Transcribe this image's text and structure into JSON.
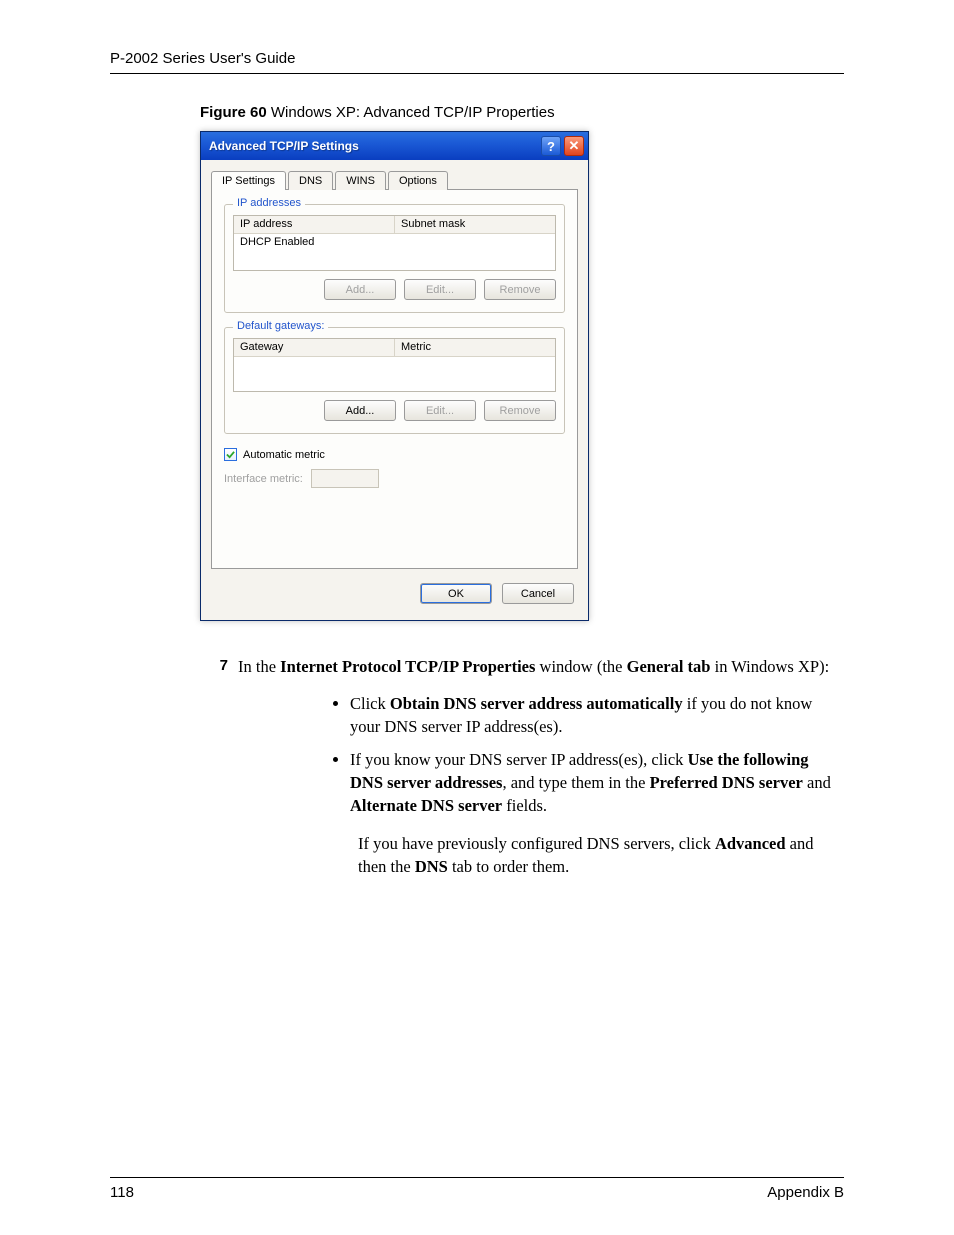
{
  "header": {
    "title": "P-2002 Series User's Guide"
  },
  "figure": {
    "label_bold": "Figure 60",
    "label_rest": "   Windows XP: Advanced TCP/IP Properties"
  },
  "dialog": {
    "title": "Advanced TCP/IP Settings",
    "tabs": {
      "ip": "IP Settings",
      "dns": "DNS",
      "wins": "WINS",
      "options": "Options"
    },
    "group_ip": {
      "legend": "IP addresses",
      "col1": "IP address",
      "col2": "Subnet mask",
      "row1": "DHCP Enabled"
    },
    "group_gw": {
      "legend": "Default gateways:",
      "col1": "Gateway",
      "col2": "Metric"
    },
    "btns": {
      "add": "Add...",
      "edit": "Edit...",
      "remove": "Remove"
    },
    "auto_metric": "Automatic metric",
    "if_metric": "Interface metric:",
    "ok": "OK",
    "cancel": "Cancel"
  },
  "step": {
    "num": "7",
    "text_pre": "In the ",
    "b1": "Internet Protocol TCP/IP Properties",
    "text_mid": " window (the ",
    "b2": "General tab",
    "text_post": " in Windows XP):"
  },
  "bullets": {
    "a_pre": "Click ",
    "a_b1": "Obtain DNS server address automatically",
    "a_post": " if you do not know your DNS server IP address(es).",
    "b_pre": "If you know your DNS server IP address(es), click ",
    "b_b1": "Use the following DNS server addresses",
    "b_mid1": ", and type them in the ",
    "b_b2": "Preferred DNS server",
    "b_mid2": " and ",
    "b_b3": "Alternate DNS server",
    "b_post": " fields."
  },
  "note": {
    "pre": "If you have previously configured DNS servers, click ",
    "b1": "Advanced",
    "mid": " and then the ",
    "b2": "DNS",
    "post": " tab to order them."
  },
  "footer": {
    "page": "118",
    "section": "Appendix B"
  }
}
